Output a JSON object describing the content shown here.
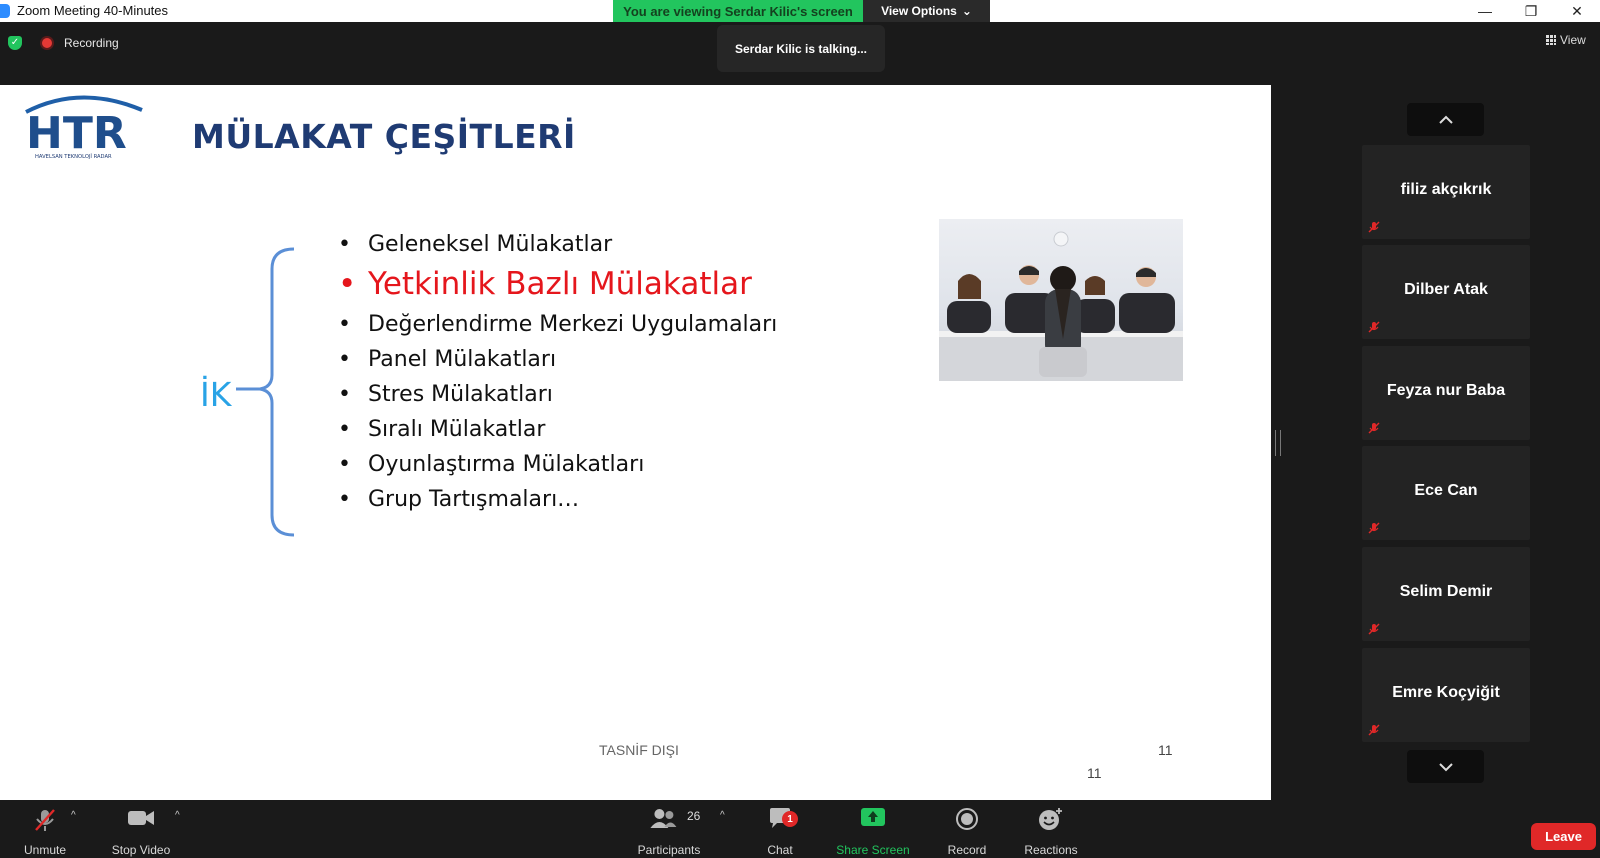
{
  "window": {
    "title": "Zoom Meeting 40-Minutes",
    "viewing_banner": "You are viewing Serdar Kilic's screen",
    "view_options": "View Options"
  },
  "meeting": {
    "recording_label": "Recording",
    "talking_notice": "Serdar Kilic is talking...",
    "view_label": "View"
  },
  "slide": {
    "title": "MÜLAKAT ÇEŞİTLERİ",
    "logo_text": "HTR",
    "logo_subtitle": "HAVELSAN TEKNOLOJİ RADAR",
    "group_label": "İK",
    "bullets": [
      "Geleneksel Mülakatlar",
      "Yetkinlik Bazlı Mülakatlar",
      "Değerlendirme Merkezi Uygulamaları",
      "Panel Mülakatları",
      "Stres Mülakatları",
      "Sıralı Mülakatlar",
      "Oyunlaştırma Mülakatları",
      "Grup Tartışmaları…"
    ],
    "highlighted_index": 1,
    "classification": "TASNİF DIŞI",
    "page_number": "11",
    "page_number_2": "11"
  },
  "participants_panel": [
    {
      "name": "filiz akçıkrık",
      "muted": true
    },
    {
      "name": "Dilber Atak",
      "muted": true
    },
    {
      "name": "Feyza nur Baba",
      "muted": true
    },
    {
      "name": "Ece Can",
      "muted": true
    },
    {
      "name": "Selim Demir",
      "muted": true
    },
    {
      "name": "Emre Koçyiğit",
      "muted": true
    }
  ],
  "toolbar": {
    "unmute": "Unmute",
    "stop_video": "Stop Video",
    "participants": "Participants",
    "participants_count": "26",
    "chat": "Chat",
    "chat_badge": "1",
    "share_screen": "Share Screen",
    "record": "Record",
    "reactions": "Reactions",
    "leave": "Leave"
  },
  "colors": {
    "share_green": "#22c55e",
    "leave_red": "#e02828",
    "title_blue": "#1f3b73",
    "ik_blue": "#29a3e6",
    "highlight_red": "#e5161c"
  }
}
